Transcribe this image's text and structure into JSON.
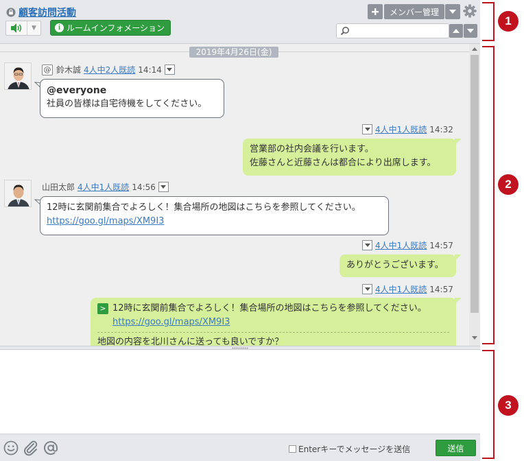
{
  "header": {
    "room_title": "顧客訪問活動",
    "info_button": "ルームインフォメーション",
    "member_button": "メンバー管理",
    "search_placeholder": "",
    "accent_green": "#2e9c3f",
    "link_blue": "#2a6fb6"
  },
  "chat": {
    "date_separator": "2019年4月26日(金)",
    "messages": [
      {
        "direction": "in",
        "sender": "鈴木誠",
        "read_status": "4人中2人既読",
        "time": "14:14",
        "mention": "@everyone",
        "text": "社員の皆様は自宅待機をしてください。"
      },
      {
        "direction": "out",
        "read_status": "4人中1人既読",
        "time": "14:32",
        "line1": "営業部の社内会議を行います。",
        "line2": "佐藤さんと近藤さんは都合により出席します。"
      },
      {
        "direction": "in",
        "sender": "山田太郎",
        "read_status": "4人中1人既読",
        "time": "14:56",
        "text": "12時に玄関前集合でよろしく！集合場所の地図はこちらを参照してください。",
        "link": "https://goo.gl/maps/XM9I3"
      },
      {
        "direction": "out",
        "read_status": "4人中1人既読",
        "time": "14:57",
        "text": "ありがとうございます。"
      },
      {
        "direction": "out",
        "read_status": "4人中1人既読",
        "time": "14:57",
        "reply_badge": ">",
        "quote_text": "12時に玄関前集合でよろしく！集合場所の地図はこちらを参照してください。",
        "quote_link": "https://goo.gl/maps/XM9I3",
        "text": "地図の内容を北川さんに送っても良いですか？"
      }
    ]
  },
  "footer": {
    "enter_to_send": "Enterキーでメッセージを送信",
    "send_button": "送信"
  },
  "annotations": [
    "1",
    "2",
    "3"
  ]
}
